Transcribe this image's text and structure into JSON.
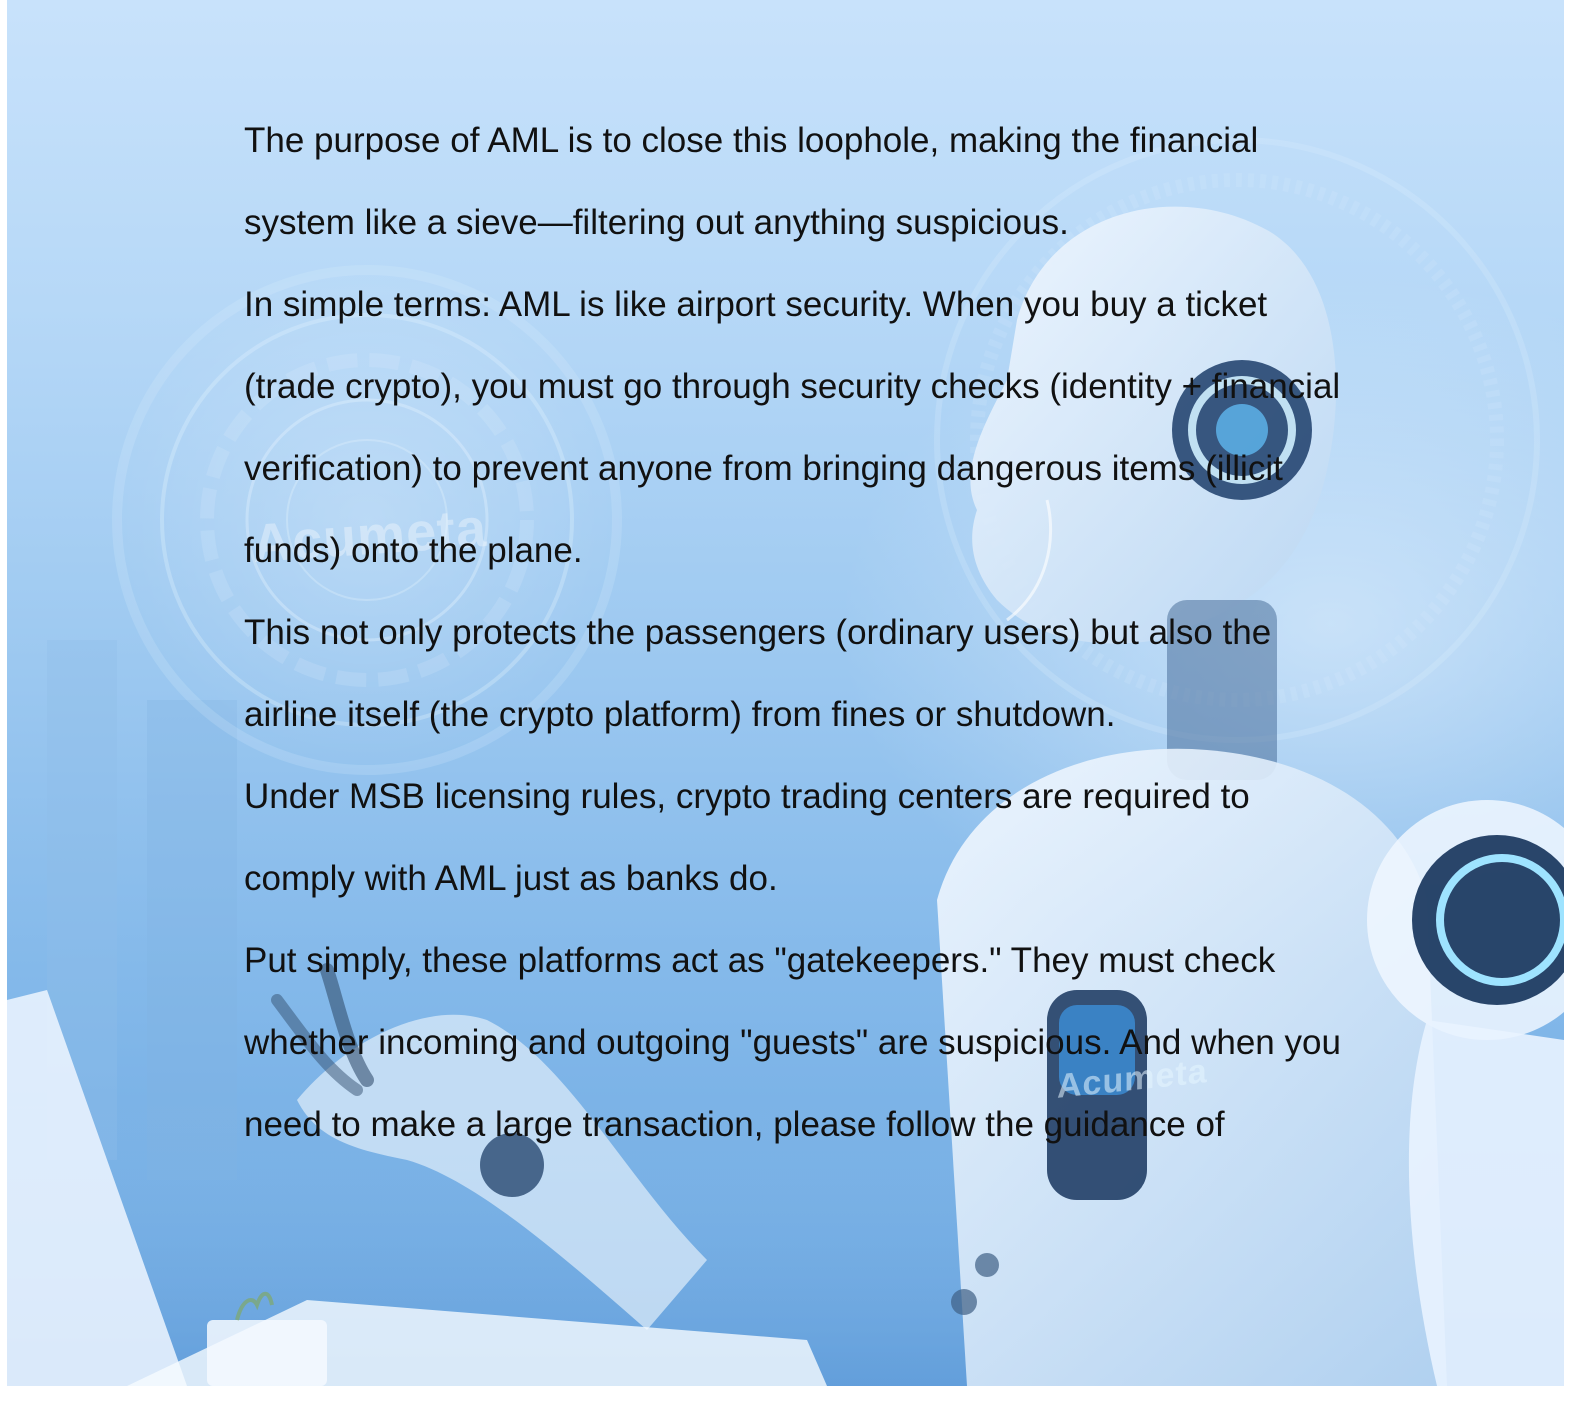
{
  "background": {
    "description_icon": "ai-robot-illustration",
    "accent": "#9fcaf1",
    "watermarks": [
      "Acumeta",
      "Acumeta"
    ]
  },
  "body": {
    "paragraphs": [
      "The purpose of AML is to close this loophole, making the financial system like a sieve—filtering out anything suspicious.",
      "In simple terms: AML is like airport security. When you buy a ticket (trade crypto), you must go through security checks (identity + financial verification) to prevent anyone from bringing dangerous items (illicit funds) onto the plane.",
      "This not only protects the passengers (ordinary users) but also the airline itself (the crypto platform) from fines or shutdown.",
      "Under MSB licensing rules, crypto trading centers are required to comply with AML just as banks do.",
      "Put simply, these platforms act as \"gatekeepers.\" They must check whether incoming and outgoing \"guests\" are suspicious. And when you need to make a large transaction, please follow the guidance of"
    ]
  }
}
